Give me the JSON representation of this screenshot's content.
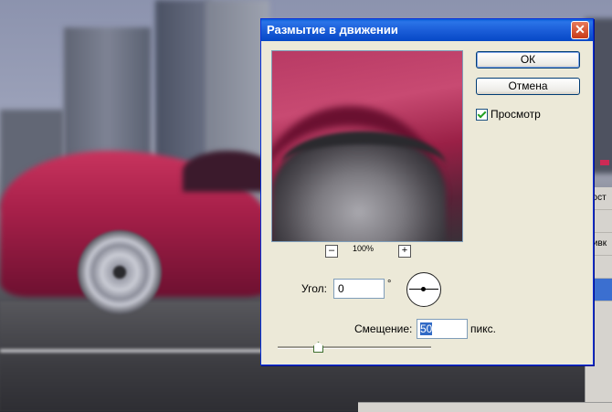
{
  "dialog": {
    "title": "Размытие в движении",
    "close_icon": "close-icon",
    "ok_label": "ОК",
    "cancel_label": "Отмена",
    "preview_label": "Просмотр",
    "preview_checked": true,
    "zoom": {
      "minus": "–",
      "plus": "+",
      "value": "100%"
    },
    "angle": {
      "label": "Угол:",
      "value": "0",
      "unit": "°"
    },
    "offset": {
      "label": "Смещение:",
      "value": "50",
      "unit": "пикс."
    }
  },
  "background_panel": {
    "rows": [
      "ност",
      "",
      "ливк",
      "",
      ""
    ]
  },
  "colors": {
    "titlebar": "#0a5fd8",
    "dialog_bg": "#ece9d8",
    "selection": "#316ac5"
  }
}
